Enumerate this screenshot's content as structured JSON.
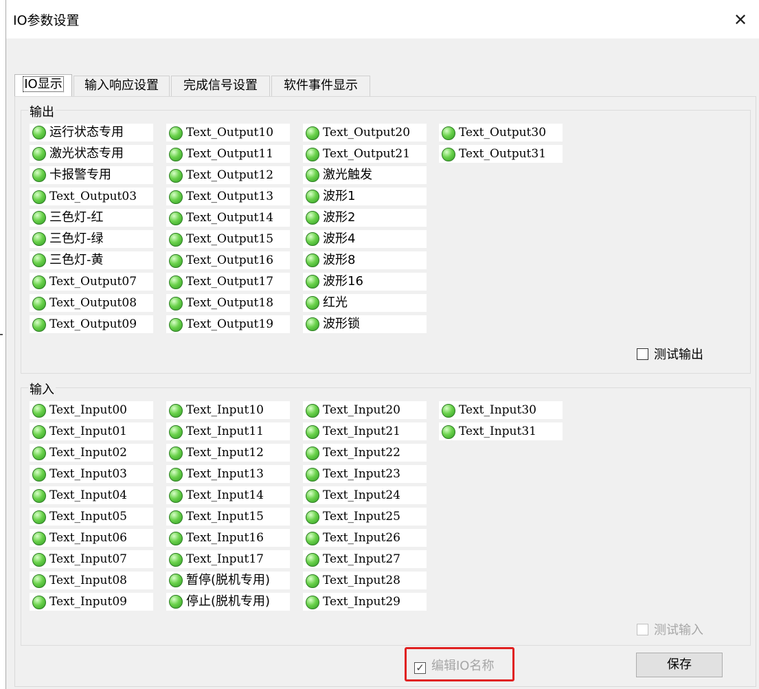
{
  "window": {
    "title": "IO参数设置",
    "close_label": "✕"
  },
  "tabs": [
    {
      "label": "IO显示",
      "active": true
    },
    {
      "label": "输入响应设置",
      "active": false
    },
    {
      "label": "完成信号设置",
      "active": false
    },
    {
      "label": "软件事件显示",
      "active": false
    }
  ],
  "output_group": {
    "label": "输出",
    "columns": [
      [
        "运行状态专用",
        "激光状态专用",
        "卡报警专用",
        "Text_Output03",
        "三色灯-红",
        "三色灯-绿",
        "三色灯-黄",
        "Text_Output07",
        "Text_Output08",
        "Text_Output09"
      ],
      [
        "Text_Output10",
        "Text_Output11",
        "Text_Output12",
        "Text_Output13",
        "Text_Output14",
        "Text_Output15",
        "Text_Output16",
        "Text_Output17",
        "Text_Output18",
        "Text_Output19"
      ],
      [
        "Text_Output20",
        "Text_Output21",
        "激光触发",
        "波形1",
        "波形2",
        "波形4",
        "波形8",
        "波形16",
        "红光",
        "波形锁"
      ],
      [
        "Text_Output30",
        "Text_Output31"
      ]
    ],
    "test_checkbox": {
      "label": "测试输出",
      "checked": false
    }
  },
  "input_group": {
    "label": "输入",
    "columns": [
      [
        "Text_Input00",
        "Text_Input01",
        "Text_Input02",
        "Text_Input03",
        "Text_Input04",
        "Text_Input05",
        "Text_Input06",
        "Text_Input07",
        "Text_Input08",
        "Text_Input09"
      ],
      [
        "Text_Input10",
        "Text_Input11",
        "Text_Input12",
        "Text_Input13",
        "Text_Input14",
        "Text_Input15",
        "Text_Input16",
        "Text_Input17",
        "暂停(脱机专用)",
        "停止(脱机专用)"
      ],
      [
        "Text_Input20",
        "Text_Input21",
        "Text_Input22",
        "Text_Input23",
        "Text_Input24",
        "Text_Input25",
        "Text_Input26",
        "Text_Input27",
        "Text_Input28",
        "Text_Input29"
      ],
      [
        "Text_Input30",
        "Text_Input31"
      ]
    ],
    "test_checkbox": {
      "label": "测试输入",
      "checked": false,
      "disabled": true
    }
  },
  "edit_names_checkbox": {
    "label": "编辑IO名称",
    "checked": true,
    "disabled": true,
    "check_mark": "✓"
  },
  "save_button": {
    "label": "保存"
  },
  "colors": {
    "led_on": "#6bd24c",
    "highlight": "#e02020",
    "window_bg": "#f0f0f0"
  },
  "icons": {
    "led": "green-led-indicator-icon",
    "close": "close-x-icon",
    "check": "checkmark-icon"
  }
}
